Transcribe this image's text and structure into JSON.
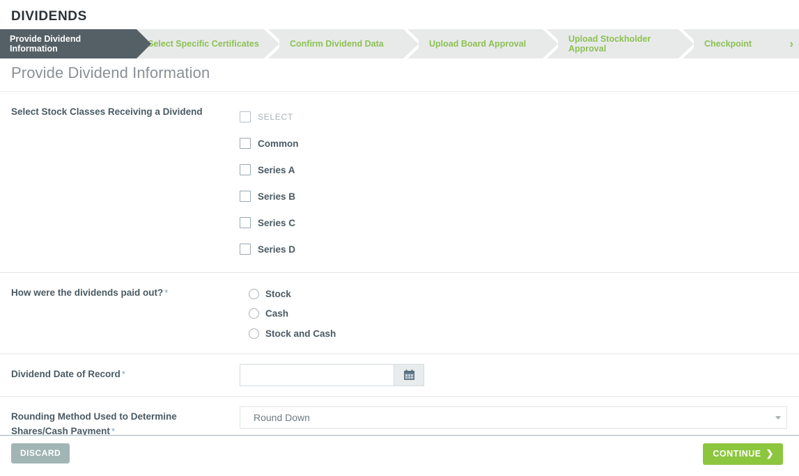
{
  "header": {
    "title": "DIVIDENDS"
  },
  "wizard": {
    "next_arrow": "›",
    "steps": [
      {
        "label": "Provide Dividend Information",
        "state": "active"
      },
      {
        "label": "Select Specific Certificates",
        "state": "upcoming"
      },
      {
        "label": "Confirm Dividend Data",
        "state": "upcoming"
      },
      {
        "label": "Upload Board Approval",
        "state": "upcoming"
      },
      {
        "label": "Upload Stockholder Approval",
        "state": "upcoming"
      },
      {
        "label": "Checkpoint",
        "state": "upcoming"
      }
    ]
  },
  "section": {
    "heading": "Provide Dividend Information"
  },
  "form": {
    "stock_classes": {
      "label": "Select Stock Classes Receiving a Dividend",
      "required": false,
      "options": [
        {
          "label": "SELECT",
          "checked": false,
          "muted": true
        },
        {
          "label": "Common",
          "checked": false,
          "muted": false
        },
        {
          "label": "Series A",
          "checked": false,
          "muted": false
        },
        {
          "label": "Series B",
          "checked": false,
          "muted": false
        },
        {
          "label": "Series C",
          "checked": false,
          "muted": false
        },
        {
          "label": "Series D",
          "checked": false,
          "muted": false
        }
      ]
    },
    "payout_method": {
      "label": "How were the dividends paid out?",
      "required_marker": "*",
      "options": [
        {
          "label": "Stock",
          "selected": false
        },
        {
          "label": "Cash",
          "selected": false
        },
        {
          "label": "Stock and Cash",
          "selected": false
        }
      ]
    },
    "date_of_record": {
      "label": "Dividend Date of Record",
      "required_marker": "*",
      "value": "",
      "placeholder": "",
      "calendar_icon": "calendar-icon"
    },
    "rounding_method": {
      "label": "Rounding Method Used to Determine Shares/Cash Payment",
      "required_marker": "*",
      "selected": "Round Down"
    }
  },
  "footer": {
    "discard_label": "DISCARD",
    "continue_label": "CONTINUE",
    "continue_chevron": "❯"
  },
  "colors": {
    "accent_green": "#8cc152",
    "button_green": "#8cc63e",
    "active_step_bg": "#545f66",
    "wizard_bg": "#e8eaea",
    "required_marker": "#7ca5c0",
    "discard_bg": "#a2b5b5"
  }
}
